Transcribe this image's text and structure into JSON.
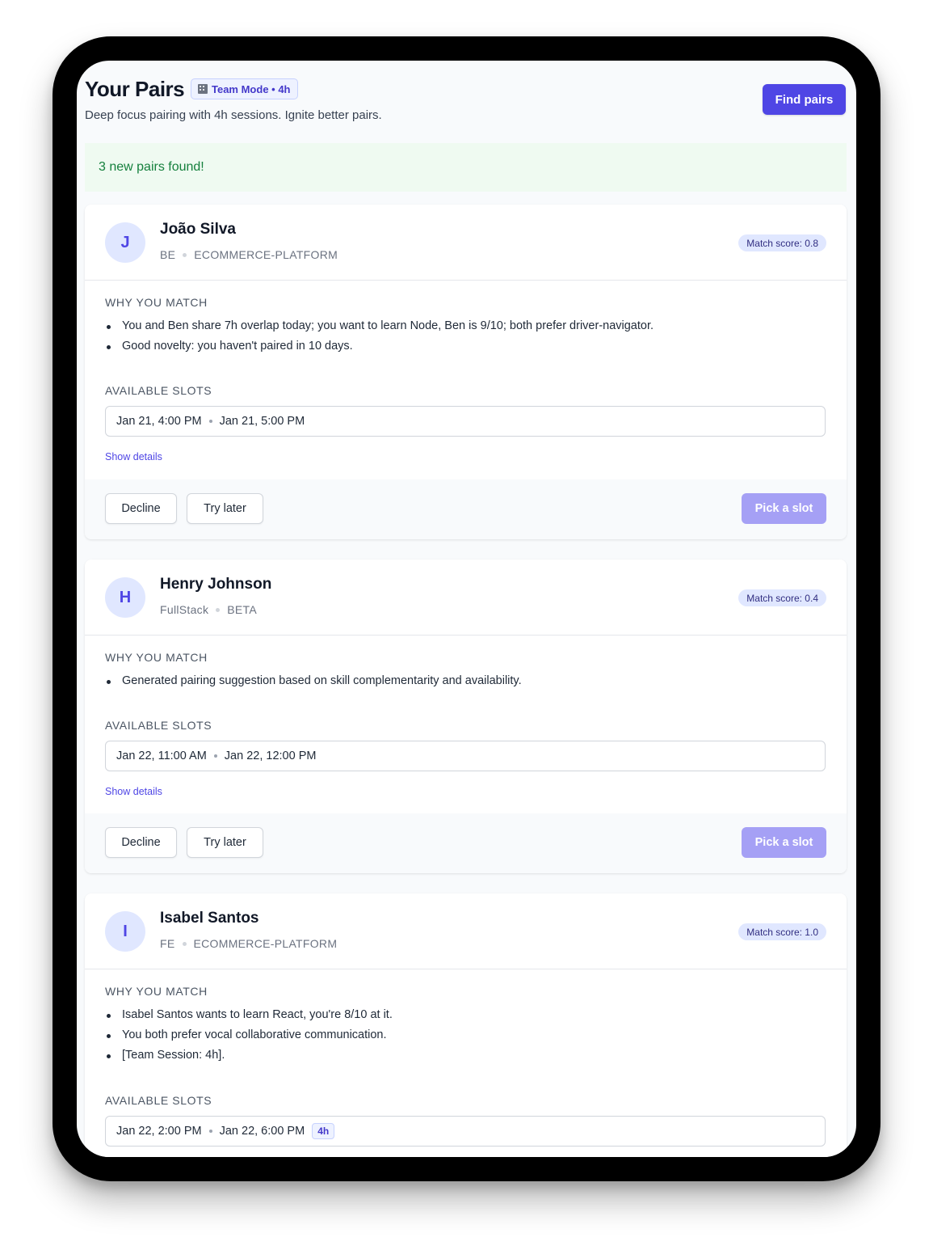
{
  "header": {
    "title": "Your Pairs",
    "mode_badge": "Team Mode • 4h",
    "mode_icon": "building-icon",
    "subtitle": "Deep focus pairing with 4h sessions. Ignite better pairs.",
    "find_button": "Find pairs"
  },
  "alert": {
    "text": "3 new pairs found!"
  },
  "labels": {
    "why": "WHY YOU MATCH",
    "slots": "AVAILABLE SLOTS",
    "show_details": "Show details",
    "decline": "Decline",
    "try_later": "Try later",
    "pick_slot": "Pick a slot"
  },
  "pairs": [
    {
      "initial": "J",
      "name": "João Silva",
      "role": "BE",
      "project": "ECOMMERCE-PLATFORM",
      "score": "Match score: 0.8",
      "reasons": [
        "You and Ben share 7h overlap today; you want to learn Node, Ben is 9/10; both prefer driver-navigator.",
        "Good novelty: you haven't paired in 10 days."
      ],
      "slot": {
        "start": "Jan 21, 4:00 PM",
        "end": "Jan 21, 5:00 PM"
      }
    },
    {
      "initial": "H",
      "name": "Henry Johnson",
      "role": "FullStack",
      "project": "BETA",
      "score": "Match score: 0.4",
      "reasons": [
        "Generated pairing suggestion based on skill complementarity and availability."
      ],
      "slot": {
        "start": "Jan 22, 11:00 AM",
        "end": "Jan 22, 12:00 PM"
      }
    },
    {
      "initial": "I",
      "name": "Isabel Santos",
      "role": "FE",
      "project": "ECOMMERCE-PLATFORM",
      "score": "Match score: 1.0",
      "reasons": [
        "Isabel Santos wants to learn React, you're 8/10 at it.",
        "You both prefer vocal collaborative communication.",
        "[Team Session: 4h]."
      ],
      "slot": {
        "start": "Jan 22, 2:00 PM",
        "end": "Jan 22, 6:00 PM",
        "duration": "4h"
      }
    }
  ],
  "colors": {
    "accent": "#4f46e5",
    "alert_bg": "#effaf1",
    "alert_text": "#15803d",
    "pick_disabled": "#a5a0f5"
  }
}
